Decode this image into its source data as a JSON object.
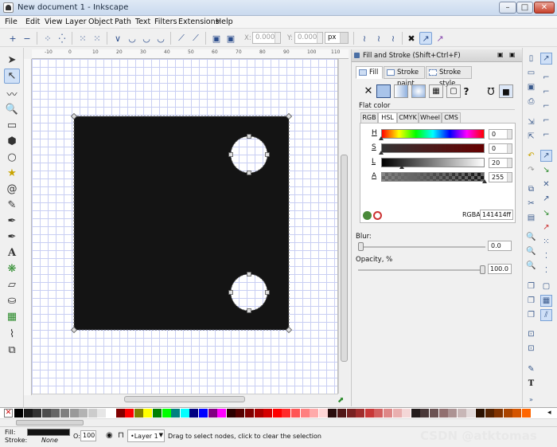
{
  "window": {
    "title": "New document 1 - Inkscape",
    "min": "–",
    "max": "□",
    "close": "✕"
  },
  "menu": [
    "File",
    "Edit",
    "View",
    "Layer",
    "Object",
    "Path",
    "Text",
    "Filters",
    "Extensions",
    "Help"
  ],
  "toolbar": {
    "x_label": "X:",
    "x_value": "0.000",
    "y_label": "Y:",
    "y_value": "0.000",
    "unit": "px"
  },
  "ruler": {
    "top_labels": [
      "-10",
      "0",
      "10",
      "20",
      "30",
      "40",
      "50",
      "60",
      "70",
      "80",
      "90",
      "100",
      "110"
    ]
  },
  "drawing": {
    "fill_color": "#141414",
    "rect": {
      "w": 270,
      "h": 268
    },
    "holes": [
      {
        "r": 23
      },
      {
        "r": 23
      }
    ]
  },
  "dock": {
    "title": "Fill and Stroke (Shift+Ctrl+F)",
    "tabs": [
      "Fill",
      "Stroke paint",
      "Stroke style"
    ],
    "fill_type": "Flat color",
    "color_tabs": [
      "RGB",
      "HSL",
      "CMYK",
      "Wheel",
      "CMS"
    ],
    "channels": [
      {
        "label": "H",
        "value": "0"
      },
      {
        "label": "S",
        "value": "0"
      },
      {
        "label": "L",
        "value": "20"
      },
      {
        "label": "A",
        "value": "255"
      }
    ],
    "rgba_label": "RGBA:",
    "rgba_value": "141414ff",
    "blur_label": "Blur:",
    "blur_value": "0.0",
    "opacity_label": "Opacity, %",
    "opacity_value": "100.0"
  },
  "palette": {
    "colors": [
      "#000000",
      "#1a1a1a",
      "#333333",
      "#4d4d4d",
      "#666666",
      "#808080",
      "#999999",
      "#b3b3b3",
      "#cccccc",
      "#e6e6e6",
      "#ffffff",
      "#800000",
      "#ff0000",
      "#808000",
      "#ffff00",
      "#008000",
      "#00ff00",
      "#008080",
      "#00ffff",
      "#000080",
      "#0000ff",
      "#800080",
      "#ff00ff",
      "#2b0000",
      "#550000",
      "#800000",
      "#aa0000",
      "#d40000",
      "#ff0000",
      "#ff2a2a",
      "#ff5555",
      "#ff8080",
      "#ffaaaa",
      "#ffd5d5",
      "#280b0b",
      "#501616",
      "#782121",
      "#a02c2c",
      "#c83737",
      "#d35f5f",
      "#de8787",
      "#e9afaf",
      "#f4d7d7",
      "#241c1c",
      "#483737",
      "#6c5353",
      "#916f6f",
      "#ac9393",
      "#c8b7b7",
      "#e3dbdb",
      "#2b1100",
      "#552200",
      "#803300",
      "#aa4400",
      "#d45500",
      "#ff6600"
    ]
  },
  "status": {
    "fill_label": "Fill:",
    "stroke_label": "Stroke:",
    "stroke_value": "None",
    "opacity_label": "O:",
    "opacity_value": "100",
    "layer": "•Layer 1",
    "message": "Drag to select nodes, click to clear the selection"
  },
  "watermark": "CSDN @atktomas"
}
